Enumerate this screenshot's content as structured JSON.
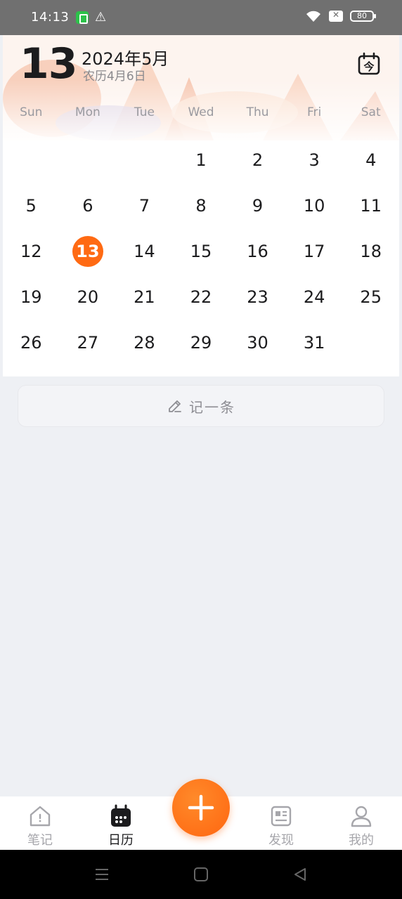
{
  "status_bar": {
    "time": "14:13",
    "battery": "80",
    "icons": [
      "app-notification-icon",
      "warning-icon",
      "wifi-icon",
      "sim-off-icon",
      "battery-icon"
    ]
  },
  "header": {
    "day": "13",
    "month_title": "2024年5月",
    "lunar": "农历4月6日",
    "today_icon": "calendar-today-icon",
    "today_icon_glyph": "今"
  },
  "weekdays": [
    "Sun",
    "Mon",
    "Tue",
    "Wed",
    "Thu",
    "Fri",
    "Sat"
  ],
  "days": [
    "",
    "",
    "",
    "1",
    "2",
    "3",
    "4",
    "5",
    "6",
    "7",
    "8",
    "9",
    "10",
    "11",
    "12",
    "13",
    "14",
    "15",
    "16",
    "17",
    "18",
    "19",
    "20",
    "21",
    "22",
    "23",
    "24",
    "25",
    "26",
    "27",
    "28",
    "29",
    "30",
    "31",
    ""
  ],
  "selected_day": "13",
  "note_bar": {
    "label": "记一条",
    "icon": "pencil-icon"
  },
  "bottom_nav": {
    "items": [
      {
        "label": "笔记",
        "icon": "notes-home-icon",
        "active": false
      },
      {
        "label": "日历",
        "icon": "calendar-icon",
        "active": true
      },
      {
        "label": "发现",
        "icon": "discover-icon",
        "active": false
      },
      {
        "label": "我的",
        "icon": "profile-icon",
        "active": false
      }
    ],
    "fab_icon": "plus-icon"
  },
  "colors": {
    "accent": "#ff6a13",
    "status_bar": "#707070",
    "background": "#eef0f4"
  }
}
